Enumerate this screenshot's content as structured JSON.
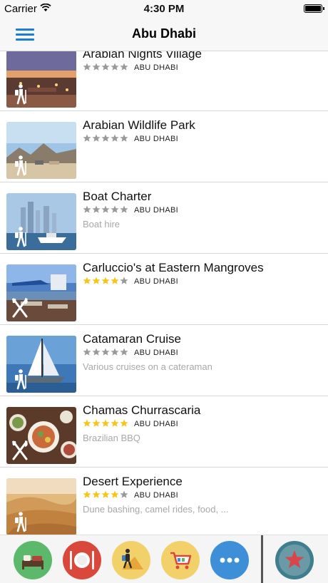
{
  "status_bar": {
    "carrier": "Carrier",
    "time": "4:30 PM"
  },
  "nav": {
    "title": "Abu Dhabi",
    "menu_icon": "hamburger-menu-icon"
  },
  "list": {
    "items": [
      {
        "title": "Arabian Nights Village",
        "rating": 0,
        "city": "ABU DHABI",
        "subtitle": "",
        "category_icon": "hiker-icon",
        "thumb_theme": "dusk-village"
      },
      {
        "title": "Arabian Wildlife Park",
        "rating": 0,
        "city": "ABU DHABI",
        "subtitle": "",
        "category_icon": "hiker-icon",
        "thumb_theme": "desert-rocks"
      },
      {
        "title": "Boat Charter",
        "rating": 0,
        "city": "ABU DHABI",
        "subtitle": "Boat hire",
        "category_icon": "hiker-icon",
        "thumb_theme": "marina-skyline"
      },
      {
        "title": "Carluccio's at Eastern Mangroves",
        "rating": 4,
        "city": "ABU DHABI",
        "subtitle": "",
        "category_icon": "fork-knife-icon",
        "thumb_theme": "waterfront-terrace"
      },
      {
        "title": "Catamaran Cruise",
        "rating": 0,
        "city": "ABU DHABI",
        "subtitle": "Various cruises on a cateraman",
        "category_icon": "hiker-icon",
        "thumb_theme": "sailboat"
      },
      {
        "title": "Chamas Churrascaria",
        "rating": 5,
        "city": "ABU DHABI",
        "subtitle": "Brazilian BBQ",
        "category_icon": "fork-knife-icon",
        "thumb_theme": "food-plates"
      },
      {
        "title": "Desert Experience",
        "rating": 4,
        "city": "ABU DHABI",
        "subtitle": "Dune bashing, camel rides, food, ...",
        "category_icon": "hiker-icon",
        "thumb_theme": "sand-dunes"
      }
    ]
  },
  "tabbar": {
    "tabs": [
      {
        "name": "hotels-tab",
        "icon": "bed-icon",
        "color": "#5cb96b"
      },
      {
        "name": "dining-tab",
        "icon": "plate-cutlery-icon",
        "color": "#d9483b"
      },
      {
        "name": "activities-tab",
        "icon": "hiker-icon",
        "color": "#f2d16b"
      },
      {
        "name": "shopping-tab",
        "icon": "shopping-cart-icon",
        "color": "#f2d16b"
      },
      {
        "name": "more-tab",
        "icon": "more-dots-icon",
        "color": "#3d8fd8"
      },
      {
        "name": "favorites-tab",
        "icon": "star-icon",
        "color": "#3f7e8e"
      }
    ]
  },
  "colors": {
    "accent": "#1a7ed4",
    "star_on": "#f5c518",
    "star_off": "#9a9a9a"
  }
}
